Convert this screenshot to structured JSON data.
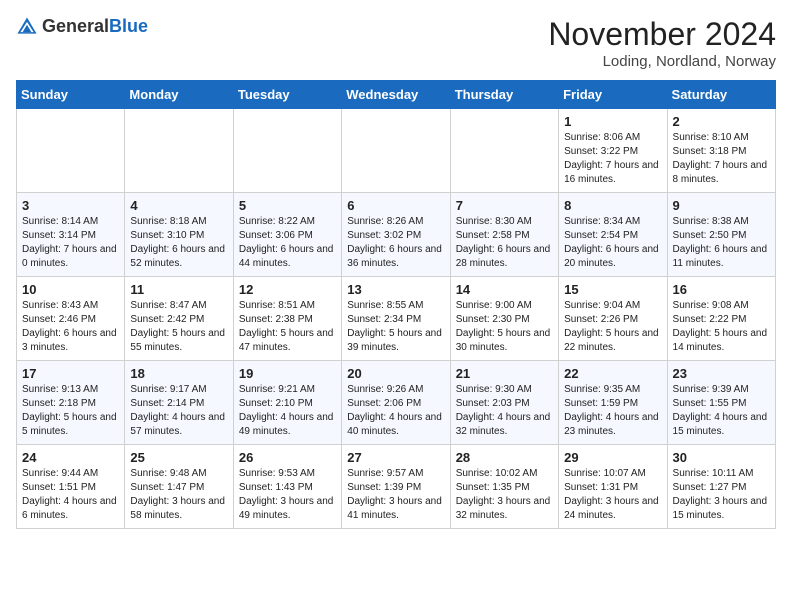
{
  "header": {
    "logo_general": "General",
    "logo_blue": "Blue",
    "title": "November 2024",
    "subtitle": "Loding, Nordland, Norway"
  },
  "calendar": {
    "days_of_week": [
      "Sunday",
      "Monday",
      "Tuesday",
      "Wednesday",
      "Thursday",
      "Friday",
      "Saturday"
    ],
    "weeks": [
      [
        {
          "day": "",
          "info": ""
        },
        {
          "day": "",
          "info": ""
        },
        {
          "day": "",
          "info": ""
        },
        {
          "day": "",
          "info": ""
        },
        {
          "day": "",
          "info": ""
        },
        {
          "day": "1",
          "info": "Sunrise: 8:06 AM\nSunset: 3:22 PM\nDaylight: 7 hours and 16 minutes."
        },
        {
          "day": "2",
          "info": "Sunrise: 8:10 AM\nSunset: 3:18 PM\nDaylight: 7 hours and 8 minutes."
        }
      ],
      [
        {
          "day": "3",
          "info": "Sunrise: 8:14 AM\nSunset: 3:14 PM\nDaylight: 7 hours and 0 minutes."
        },
        {
          "day": "4",
          "info": "Sunrise: 8:18 AM\nSunset: 3:10 PM\nDaylight: 6 hours and 52 minutes."
        },
        {
          "day": "5",
          "info": "Sunrise: 8:22 AM\nSunset: 3:06 PM\nDaylight: 6 hours and 44 minutes."
        },
        {
          "day": "6",
          "info": "Sunrise: 8:26 AM\nSunset: 3:02 PM\nDaylight: 6 hours and 36 minutes."
        },
        {
          "day": "7",
          "info": "Sunrise: 8:30 AM\nSunset: 2:58 PM\nDaylight: 6 hours and 28 minutes."
        },
        {
          "day": "8",
          "info": "Sunrise: 8:34 AM\nSunset: 2:54 PM\nDaylight: 6 hours and 20 minutes."
        },
        {
          "day": "9",
          "info": "Sunrise: 8:38 AM\nSunset: 2:50 PM\nDaylight: 6 hours and 11 minutes."
        }
      ],
      [
        {
          "day": "10",
          "info": "Sunrise: 8:43 AM\nSunset: 2:46 PM\nDaylight: 6 hours and 3 minutes."
        },
        {
          "day": "11",
          "info": "Sunrise: 8:47 AM\nSunset: 2:42 PM\nDaylight: 5 hours and 55 minutes."
        },
        {
          "day": "12",
          "info": "Sunrise: 8:51 AM\nSunset: 2:38 PM\nDaylight: 5 hours and 47 minutes."
        },
        {
          "day": "13",
          "info": "Sunrise: 8:55 AM\nSunset: 2:34 PM\nDaylight: 5 hours and 39 minutes."
        },
        {
          "day": "14",
          "info": "Sunrise: 9:00 AM\nSunset: 2:30 PM\nDaylight: 5 hours and 30 minutes."
        },
        {
          "day": "15",
          "info": "Sunrise: 9:04 AM\nSunset: 2:26 PM\nDaylight: 5 hours and 22 minutes."
        },
        {
          "day": "16",
          "info": "Sunrise: 9:08 AM\nSunset: 2:22 PM\nDaylight: 5 hours and 14 minutes."
        }
      ],
      [
        {
          "day": "17",
          "info": "Sunrise: 9:13 AM\nSunset: 2:18 PM\nDaylight: 5 hours and 5 minutes."
        },
        {
          "day": "18",
          "info": "Sunrise: 9:17 AM\nSunset: 2:14 PM\nDaylight: 4 hours and 57 minutes."
        },
        {
          "day": "19",
          "info": "Sunrise: 9:21 AM\nSunset: 2:10 PM\nDaylight: 4 hours and 49 minutes."
        },
        {
          "day": "20",
          "info": "Sunrise: 9:26 AM\nSunset: 2:06 PM\nDaylight: 4 hours and 40 minutes."
        },
        {
          "day": "21",
          "info": "Sunrise: 9:30 AM\nSunset: 2:03 PM\nDaylight: 4 hours and 32 minutes."
        },
        {
          "day": "22",
          "info": "Sunrise: 9:35 AM\nSunset: 1:59 PM\nDaylight: 4 hours and 23 minutes."
        },
        {
          "day": "23",
          "info": "Sunrise: 9:39 AM\nSunset: 1:55 PM\nDaylight: 4 hours and 15 minutes."
        }
      ],
      [
        {
          "day": "24",
          "info": "Sunrise: 9:44 AM\nSunset: 1:51 PM\nDaylight: 4 hours and 6 minutes."
        },
        {
          "day": "25",
          "info": "Sunrise: 9:48 AM\nSunset: 1:47 PM\nDaylight: 3 hours and 58 minutes."
        },
        {
          "day": "26",
          "info": "Sunrise: 9:53 AM\nSunset: 1:43 PM\nDaylight: 3 hours and 49 minutes."
        },
        {
          "day": "27",
          "info": "Sunrise: 9:57 AM\nSunset: 1:39 PM\nDaylight: 3 hours and 41 minutes."
        },
        {
          "day": "28",
          "info": "Sunrise: 10:02 AM\nSunset: 1:35 PM\nDaylight: 3 hours and 32 minutes."
        },
        {
          "day": "29",
          "info": "Sunrise: 10:07 AM\nSunset: 1:31 PM\nDaylight: 3 hours and 24 minutes."
        },
        {
          "day": "30",
          "info": "Sunrise: 10:11 AM\nSunset: 1:27 PM\nDaylight: 3 hours and 15 minutes."
        }
      ]
    ]
  }
}
